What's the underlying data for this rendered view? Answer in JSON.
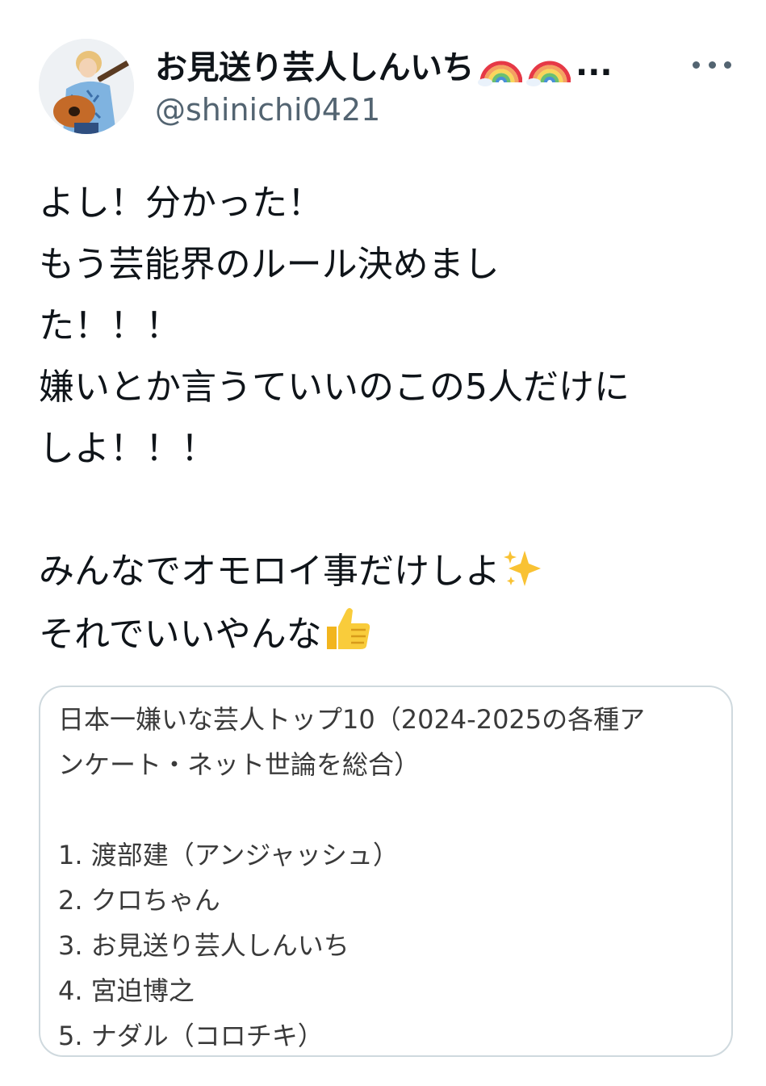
{
  "tweet": {
    "display_name": "お見送り芸人しんいち",
    "name_emojis": [
      "rainbow-emoji",
      "rainbow-emoji"
    ],
    "name_truncation": "...",
    "handle": "@shinichi0421",
    "more_icon": "more-horizontal-icon",
    "text_lines": [
      "よし！分かった！",
      "もう芸能界のルール決めまし",
      "た！！！",
      "嫌いとか言うていいのこの5人だけに",
      "しよ！！！",
      "",
      "みんなでオモロイ事だけしよ",
      "それでいいやんな"
    ],
    "inline_emojis": {
      "line7": "sparkles-emoji",
      "line8": "thumbs-up-emoji"
    }
  },
  "card": {
    "lines": [
      "日本一嫌いな芸人トップ10（2024-2025の各種ア",
      "ンケート・ネット世論を総合）",
      "",
      "1. 渡部建（アンジャッシュ）",
      "2. クロちゃん",
      "3. お見送り芸人しんいち",
      "4. 宮迫博之",
      "5. ナダル（コロチキ）"
    ]
  },
  "colors": {
    "text_primary": "#0f1419",
    "text_secondary": "#536471",
    "card_border": "#cfd9de",
    "card_text": "#3a3a3a"
  }
}
